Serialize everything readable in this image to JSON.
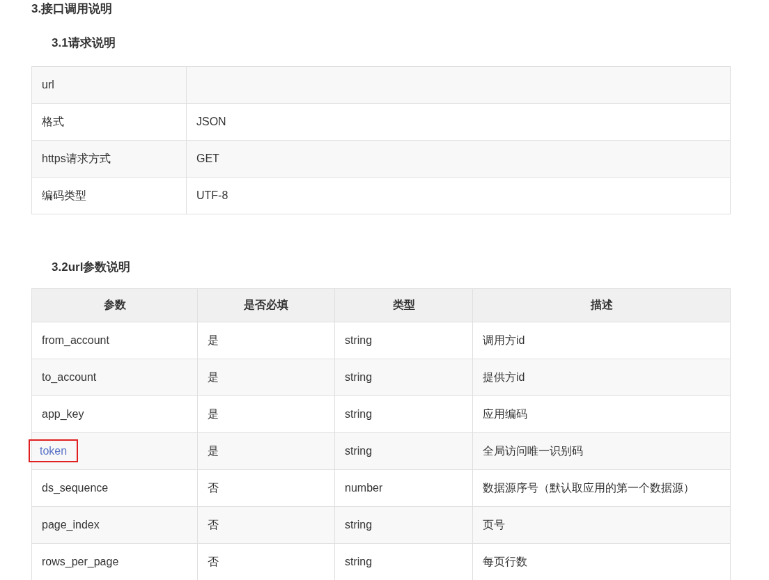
{
  "title": "3.接口调用说明",
  "request_section": {
    "heading": "3.1请求说明",
    "rows": [
      {
        "label": "url"
      },
      {
        "label": "格式",
        "value": "JSON"
      },
      {
        "label": "https请求方式",
        "value": "GET"
      },
      {
        "label": "编码类型",
        "value": "UTF-8"
      }
    ]
  },
  "params_section": {
    "heading": "3.2url参数说明",
    "columns": [
      "参数",
      "是否必填",
      "类型",
      "描述"
    ],
    "rows": [
      {
        "cells": [
          "from_account",
          "是",
          "string",
          "调用方id"
        ],
        "link": false,
        "highlighted": false
      },
      {
        "cells": [
          "to_account",
          "是",
          "string",
          "提供方id"
        ],
        "link": false,
        "highlighted": false
      },
      {
        "cells": [
          "app_key",
          "是",
          "string",
          "应用编码"
        ],
        "link": false,
        "highlighted": false
      },
      {
        "cells": [
          "token",
          "是",
          "string",
          "全局访问唯一识别码"
        ],
        "link": true,
        "highlighted": true
      },
      {
        "cells": [
          "ds_sequence",
          "否",
          "number",
          "数据源序号（默认取应用的第一个数据源）"
        ],
        "link": false,
        "highlighted": false
      },
      {
        "cells": [
          "page_index",
          "否",
          "string",
          "页号"
        ],
        "link": false,
        "highlighted": false
      },
      {
        "cells": [
          "rows_per_page",
          "否",
          "string",
          "每页行数"
        ],
        "link": false,
        "highlighted": false
      }
    ]
  }
}
